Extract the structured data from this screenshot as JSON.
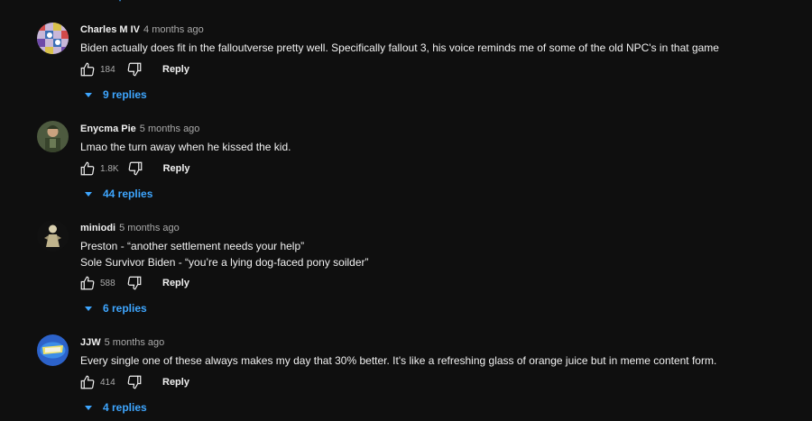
{
  "colors": {
    "background": "#0f0f0f",
    "text": "#f1f1f1",
    "muted": "#aaaaaa",
    "link": "#3ea6ff"
  },
  "comments": [
    {
      "author": "Charles M IV",
      "time": "4 months ago",
      "lines": [
        "Biden actually does fit in the falloutverse pretty well. Specifically fallout 3, his voice reminds me of some of the old NPC's in that game"
      ],
      "likes": "184",
      "reply_label": "Reply",
      "replies_label": "9 replies",
      "avatar_icon": "checkered-avatar-icon"
    },
    {
      "author": "Enycma Pie",
      "time": "5 months ago",
      "lines": [
        "Lmao the turn away when he kissed the kid."
      ],
      "likes": "1.8K",
      "reply_label": "Reply",
      "replies_label": "44 replies",
      "avatar_icon": "soldier-avatar-icon"
    },
    {
      "author": "miniodi",
      "time": "5 months ago",
      "lines": [
        "Preston - “another settlement needs your help”",
        "Sole Survivor Biden - “you’re a lying dog-faced pony soilder”"
      ],
      "likes": "588",
      "reply_label": "Reply",
      "replies_label": "6 replies",
      "avatar_icon": "figure-avatar-icon"
    },
    {
      "author": "JJW",
      "time": "5 months ago",
      "lines": [
        "Every single one of these always makes my day that 30% better. It's like a refreshing glass of orange juice but in meme content form."
      ],
      "likes": "414",
      "reply_label": "Reply",
      "replies_label": "4 replies",
      "avatar_icon": "jjw-logo-avatar-icon"
    }
  ]
}
